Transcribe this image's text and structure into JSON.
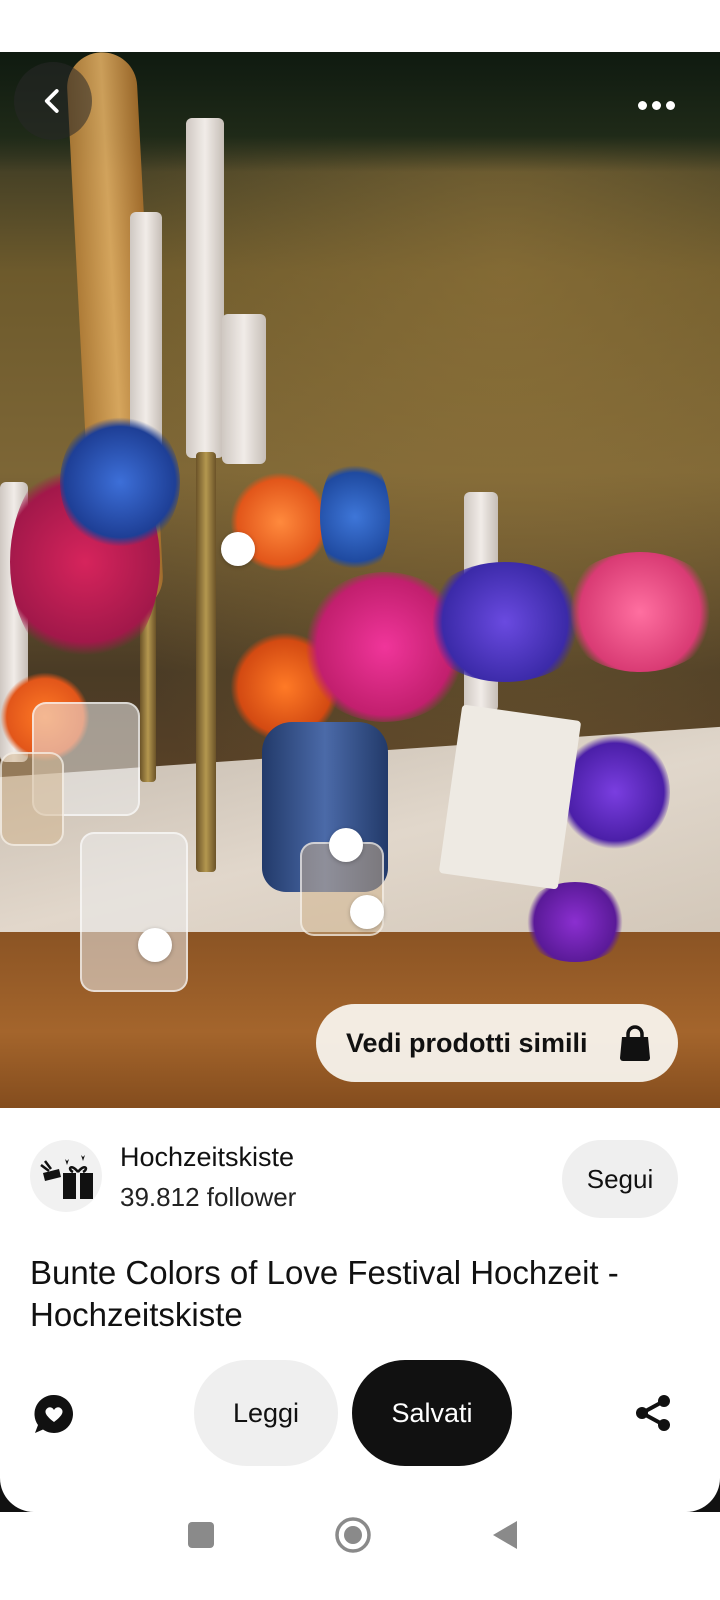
{
  "hero": {
    "similar_products_label": "Vedi prodotti simili"
  },
  "icons": {
    "back": "chevron-left-icon",
    "more": "more-horizontal-icon",
    "bag": "shopping-bag-icon",
    "comment": "comment-heart-icon",
    "share": "share-icon"
  },
  "creator": {
    "name": "Hochzeitskiste",
    "followers": "39.812 follower",
    "follow_label": "Segui"
  },
  "pin": {
    "title": "Bunte Colors of Love Festival Hochzeit - Hochzeitskiste"
  },
  "actions": {
    "read_label": "Leggi",
    "saved_label": "Salvati"
  },
  "colors": {
    "primary_button": "#111111",
    "secondary_button": "#efefef"
  }
}
